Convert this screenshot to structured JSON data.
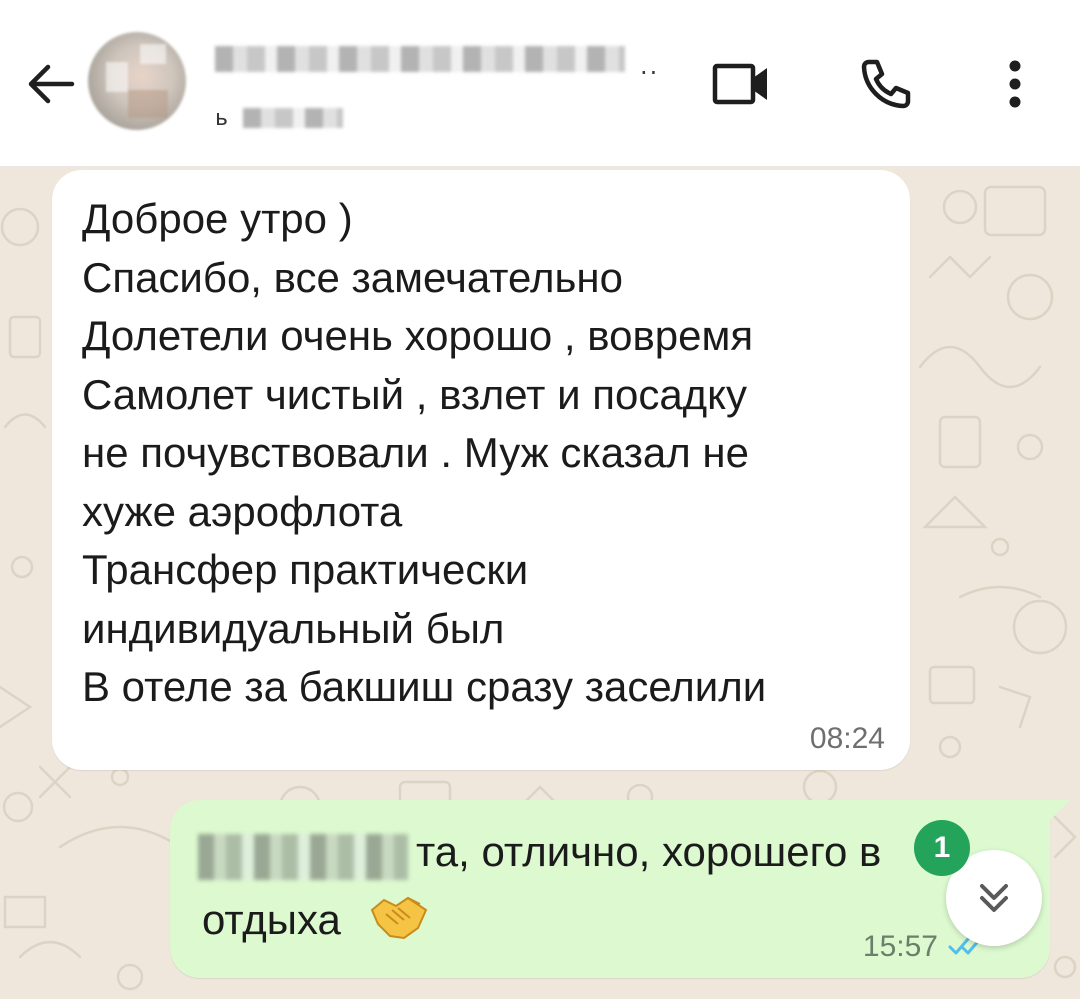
{
  "header": {
    "title_visible": "Елис... Заявк",
    "title_overflow": "..",
    "subtitle_visible": "ь",
    "back_icon": "arrow-left-icon",
    "video_icon": "video-camera-icon",
    "call_icon": "phone-icon",
    "menu_icon": "more-vertical-icon"
  },
  "chat": {
    "incoming": {
      "text": "Доброе утро )\nСпасибо, все замечательно\nДолетели очень хорошо , вовремя\nСамолет чистый , взлет и посадку\nне почувствовали . Муж сказал не\nхуже аэрофлота\nТрансфер практически\nиндивидуальный был\nВ отеле за бакшиш сразу заселили",
      "time": "08:24"
    },
    "outgoing": {
      "line1_visible": "та, отлично, хорошего в",
      "line2": "отдыха",
      "emoji": "handshake-emoji",
      "time": "15:57",
      "status": "read-double-check"
    }
  },
  "unread_badge": "1",
  "colors": {
    "wallpaper": "#efe7dc",
    "incoming_bubble": "#ffffff",
    "outgoing_bubble": "#dcf9cf",
    "badge": "#23a45a",
    "read_ticks": "#53bdeb"
  }
}
